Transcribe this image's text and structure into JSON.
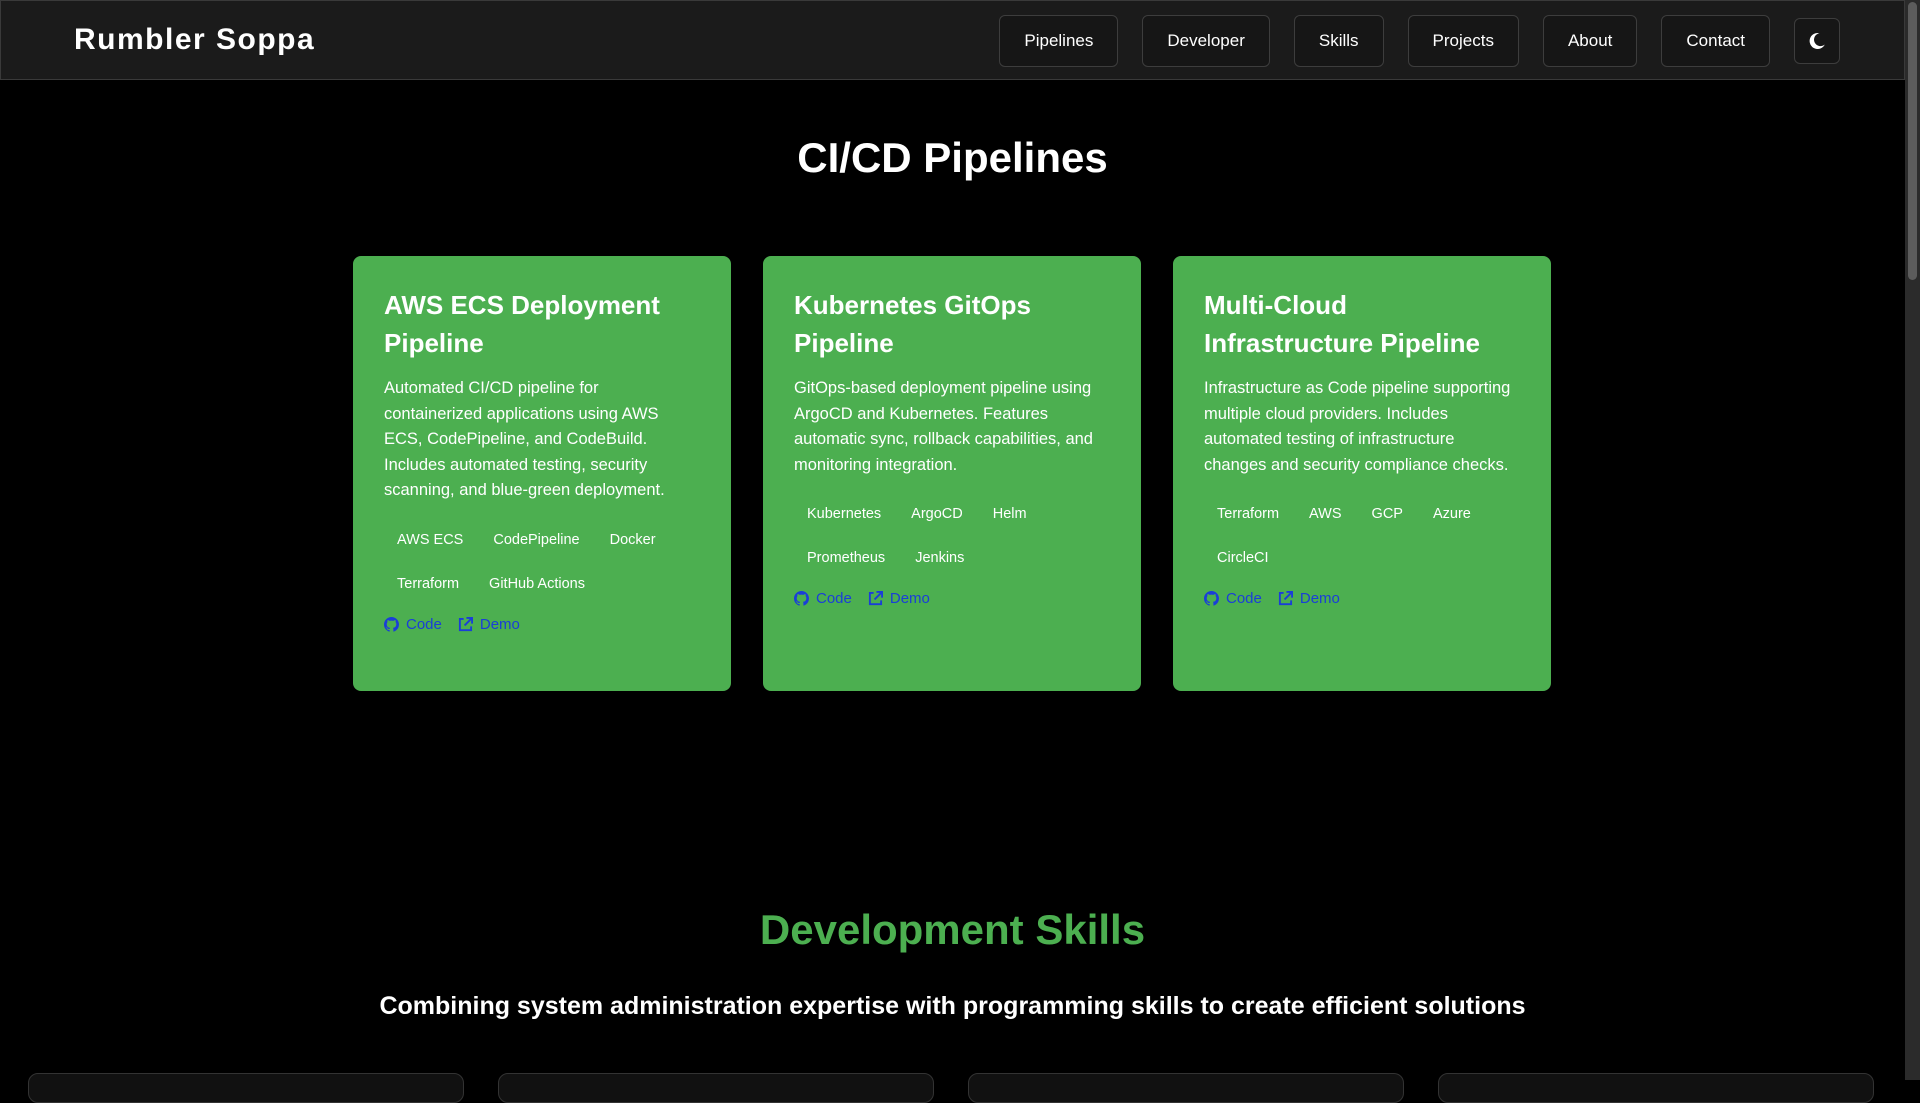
{
  "header": {
    "brand": "Rumbler Soppa",
    "nav": [
      "Pipelines",
      "Developer",
      "Skills",
      "Projects",
      "About",
      "Contact"
    ],
    "theme_icon": "moon-icon"
  },
  "pipelines": {
    "title": "CI/CD Pipelines",
    "cards": [
      {
        "title": "AWS ECS Deployment Pipeline",
        "description": "Automated CI/CD pipeline for containerized applications using AWS ECS, CodePipeline, and CodeBuild. Includes automated testing, security scanning, and blue-green deployment.",
        "tags": [
          "AWS ECS",
          "CodePipeline",
          "Docker",
          "Terraform",
          "GitHub Actions"
        ],
        "code_label": "Code",
        "demo_label": "Demo"
      },
      {
        "title": "Kubernetes GitOps Pipeline",
        "description": "GitOps-based deployment pipeline using ArgoCD and Kubernetes. Features automatic sync, rollback capabilities, and monitoring integration.",
        "tags": [
          "Kubernetes",
          "ArgoCD",
          "Helm",
          "Prometheus",
          "Jenkins"
        ],
        "code_label": "Code",
        "demo_label": "Demo"
      },
      {
        "title": "Multi-Cloud Infrastructure Pipeline",
        "description": "Infrastructure as Code pipeline supporting multiple cloud providers. Includes automated testing of infrastructure changes and security compliance checks.",
        "tags": [
          "Terraform",
          "AWS",
          "GCP",
          "Azure",
          "CircleCI"
        ],
        "code_label": "Code",
        "demo_label": "Demo"
      }
    ]
  },
  "skills": {
    "title": "Development Skills",
    "subtitle": "Combining system administration expertise with programming skills to create efficient solutions"
  },
  "colors": {
    "accent": "#4caf50",
    "link": "#1a3ed8",
    "background": "#000000",
    "header_bg": "#1b1b1b"
  }
}
